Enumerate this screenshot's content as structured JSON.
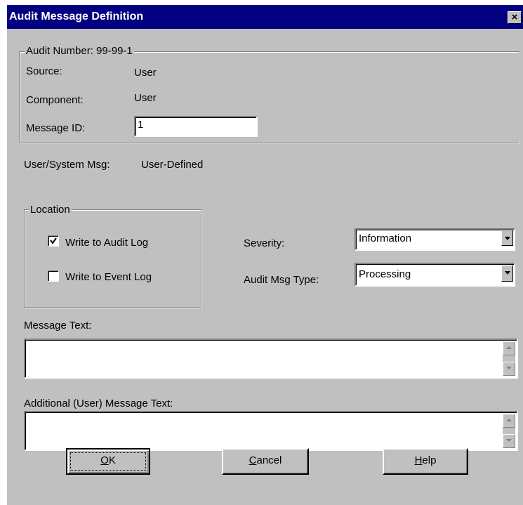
{
  "window": {
    "title": "Audit Message Definition",
    "close_glyph": "×"
  },
  "audit_group": {
    "legend": "Audit Number: 99-99-1",
    "source_label": "Source:",
    "source_value": "User",
    "component_label": "Component:",
    "component_value": "User",
    "message_id_label": "Message ID:",
    "message_id_value": "1"
  },
  "user_system": {
    "label": "User/System Msg:",
    "value": "User-Defined"
  },
  "location_group": {
    "legend": "Location",
    "write_audit_log": {
      "label": "Write to Audit Log",
      "checked": true
    },
    "write_event_log": {
      "label": "Write to Event Log",
      "checked": false
    }
  },
  "severity": {
    "label": "Severity:",
    "value": "Information"
  },
  "audit_msg_type": {
    "label": "Audit Msg Type:",
    "value": "Processing"
  },
  "message_text": {
    "label": "Message Text:",
    "value": ""
  },
  "additional_text": {
    "label": "Additional (User) Message Text:",
    "value": ""
  },
  "buttons": {
    "ok": {
      "mnemonic": "O",
      "rest": "K"
    },
    "cancel": {
      "mnemonic": "C",
      "rest": "ancel"
    },
    "help": {
      "mnemonic": "H",
      "rest": "elp"
    }
  },
  "icons": {
    "dropdown": "triangle-down",
    "scroll_up": "triangle-up",
    "scroll_down": "triangle-down",
    "check": "checkmark"
  },
  "colors": {
    "title_bar": "#000080",
    "dialog_face": "#c0c0c0",
    "field_background": "#ffffff"
  }
}
